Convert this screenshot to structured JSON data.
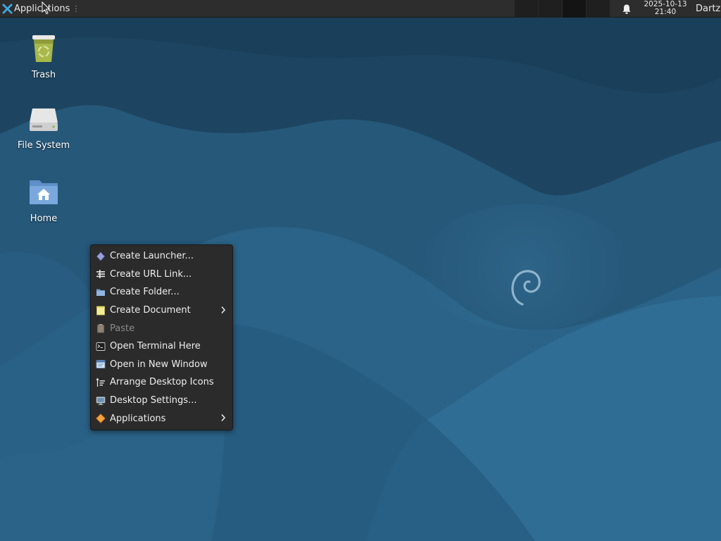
{
  "panel": {
    "applications_label": "Applications",
    "handle_glyph": "⋮",
    "clock_date": "2025-10-13",
    "clock_time": "21:40",
    "user_name": "Dartz",
    "workspaces": 4
  },
  "desktop": {
    "icons": [
      {
        "label": "Trash",
        "icon": "trash-icon"
      },
      {
        "label": "File System",
        "icon": "drive-icon"
      },
      {
        "label": "Home",
        "icon": "home-folder-icon"
      }
    ]
  },
  "context_menu": {
    "items": [
      {
        "label": "Create Launcher...",
        "icon": "launcher-icon",
        "enabled": true,
        "submenu": false
      },
      {
        "label": "Create URL Link...",
        "icon": "url-link-icon",
        "enabled": true,
        "submenu": false
      },
      {
        "label": "Create Folder...",
        "icon": "folder-icon",
        "enabled": true,
        "submenu": false
      },
      {
        "label": "Create Document",
        "icon": "document-icon",
        "enabled": true,
        "submenu": true
      },
      {
        "label": "Paste",
        "icon": "paste-icon",
        "enabled": false,
        "submenu": false
      },
      {
        "label": "Open Terminal Here",
        "icon": "terminal-icon",
        "enabled": true,
        "submenu": false
      },
      {
        "label": "Open in New Window",
        "icon": "new-window-icon",
        "enabled": true,
        "submenu": false
      },
      {
        "label": "Arrange Desktop Icons",
        "icon": "arrange-icon",
        "enabled": true,
        "submenu": false
      },
      {
        "label": "Desktop Settings...",
        "icon": "desktop-settings-icon",
        "enabled": true,
        "submenu": false
      },
      {
        "label": "Applications",
        "icon": "applications-icon",
        "enabled": true,
        "submenu": true
      }
    ]
  },
  "colors": {
    "panel_bg": "#2d2d2d",
    "menu_bg": "#2b2b2b",
    "wallpaper_dark": "#1f4a66",
    "wallpaper_light": "#2f6b91"
  }
}
